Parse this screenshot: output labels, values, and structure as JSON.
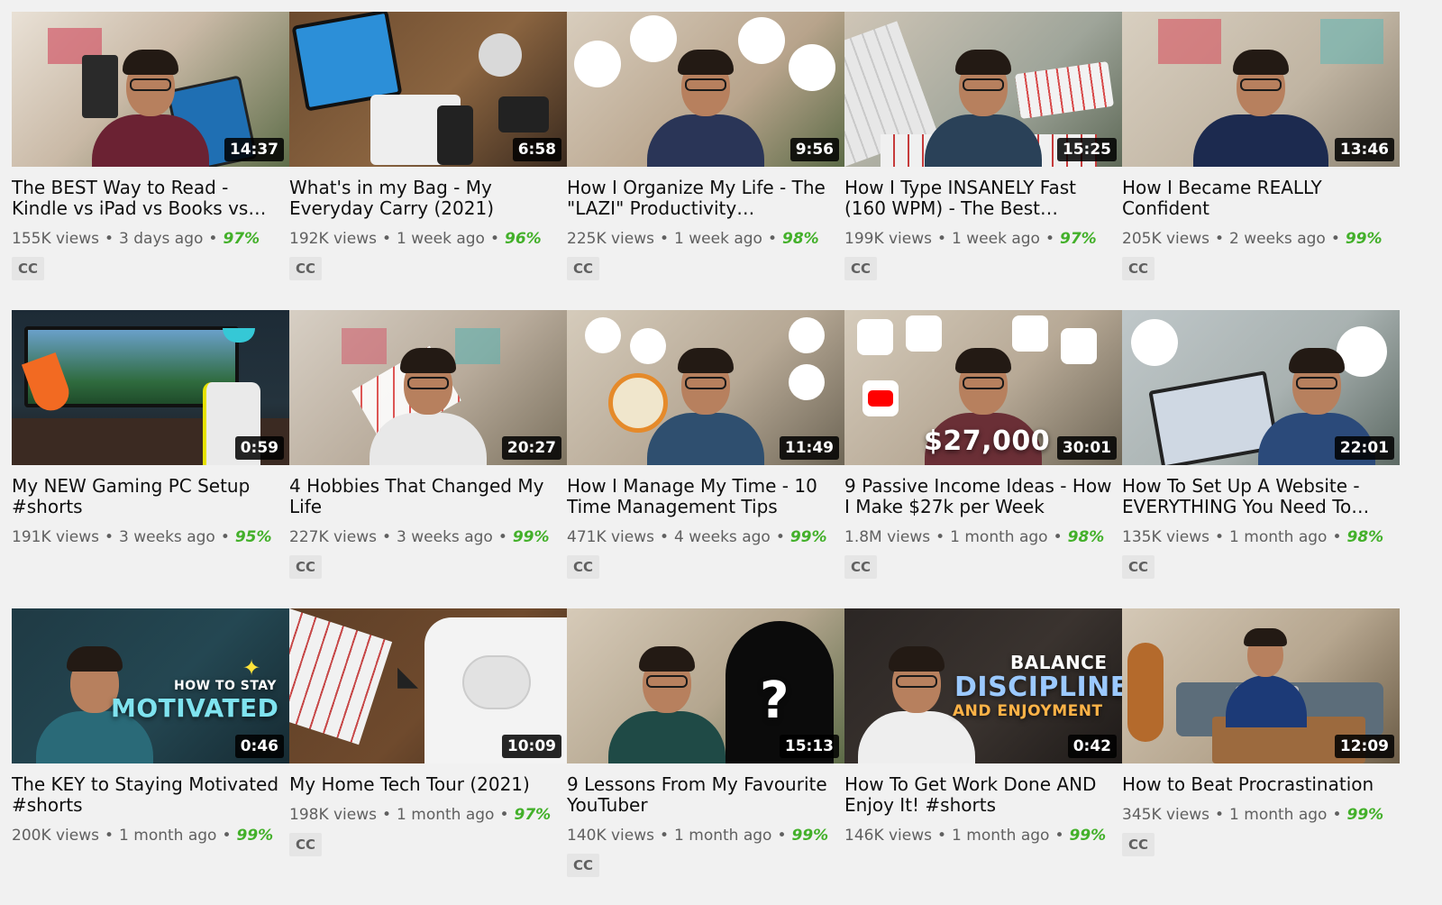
{
  "videos": [
    {
      "title": "The BEST Way to Read - Kindle vs iPad vs Books vs…",
      "duration": "14:37",
      "views": "155K views",
      "age": "3 days ago",
      "rating": "97%",
      "cc": "CC"
    },
    {
      "title": "What's in my Bag - My Everyday Carry (2021)",
      "duration": "6:58",
      "views": "192K views",
      "age": "1 week ago",
      "rating": "96%",
      "cc": "CC"
    },
    {
      "title": "How I Organize My Life - The \"LAZI\" Productivity…",
      "duration": "9:56",
      "views": "225K views",
      "age": "1 week ago",
      "rating": "98%",
      "cc": "CC"
    },
    {
      "title": "How I Type INSANELY Fast (160 WPM) - The Best…",
      "duration": "15:25",
      "views": "199K views",
      "age": "1 week ago",
      "rating": "97%",
      "cc": "CC"
    },
    {
      "title": "How I Became REALLY Confident",
      "duration": "13:46",
      "views": "205K views",
      "age": "2 weeks ago",
      "rating": "99%",
      "cc": "CC"
    },
    {
      "title": "My NEW Gaming PC Setup #shorts",
      "duration": "0:59",
      "views": "191K views",
      "age": "3 weeks ago",
      "rating": "95%",
      "cc": ""
    },
    {
      "title": "4 Hobbies That Changed My Life",
      "duration": "20:27",
      "views": "227K views",
      "age": "3 weeks ago",
      "rating": "99%",
      "cc": "CC"
    },
    {
      "title": "How I Manage My Time - 10 Time Management Tips",
      "duration": "11:49",
      "views": "471K views",
      "age": "4 weeks ago",
      "rating": "99%",
      "cc": "CC"
    },
    {
      "title": "9 Passive Income Ideas - How I Make $27k per Week",
      "duration": "30:01",
      "views": "1.8M views",
      "age": "1 month ago",
      "rating": "98%",
      "cc": "CC",
      "overlay": "$27,000"
    },
    {
      "title": "How To Set Up A Website - EVERYTHING You Need To…",
      "duration": "22:01",
      "views": "135K views",
      "age": "1 month ago",
      "rating": "98%",
      "cc": "CC"
    },
    {
      "title": "The KEY to Staying Motivated #shorts",
      "duration": "0:46",
      "views": "200K views",
      "age": "1 month ago",
      "rating": "99%",
      "cc": "",
      "overlay_small": "HOW TO STAY",
      "overlay": "MOTIVATED"
    },
    {
      "title": "My Home Tech Tour (2021)",
      "duration": "10:09",
      "views": "198K views",
      "age": "1 month ago",
      "rating": "97%",
      "cc": "CC"
    },
    {
      "title": "9 Lessons From My Favourite YouTuber",
      "duration": "15:13",
      "views": "140K views",
      "age": "1 month ago",
      "rating": "99%",
      "cc": "CC",
      "overlay": "?"
    },
    {
      "title": "How To Get Work Done AND Enjoy It! #shorts",
      "duration": "0:42",
      "views": "146K views",
      "age": "1 month ago",
      "rating": "99%",
      "cc": "",
      "overlay_small": "BALANCE",
      "overlay": "DISCIPLINE",
      "overlay_small2": "AND ENJOYMENT"
    },
    {
      "title": "How to Beat Procrastination",
      "duration": "12:09",
      "views": "345K views",
      "age": "1 month ago",
      "rating": "99%",
      "cc": "CC"
    }
  ],
  "colors": {
    "background": "#f1f1f1",
    "rating_green": "#43b02a",
    "meta_gray": "#606060"
  }
}
